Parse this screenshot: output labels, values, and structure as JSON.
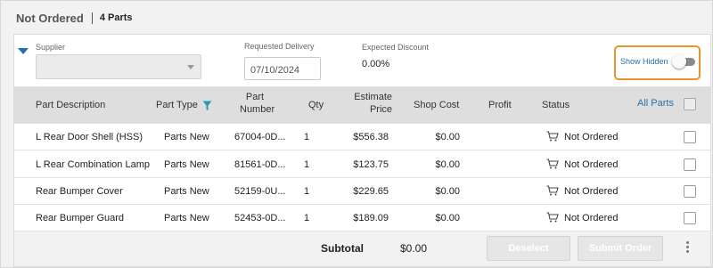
{
  "header": {
    "title": "Not Ordered",
    "count": "4 Parts"
  },
  "filters": {
    "supplier_label": "Supplier",
    "supplier_value": "",
    "requested_delivery_label": "Requested Delivery",
    "requested_delivery_value": "07/10/2024",
    "expected_discount_label": "Expected Discount",
    "expected_discount_value": "0.00%",
    "show_hidden_label": "Show Hidden",
    "show_hidden_on": false
  },
  "table": {
    "columns": {
      "part_description": "Part Description",
      "part_type": "Part Type",
      "part_number_1": "Part",
      "part_number_2": "Number",
      "qty": "Qty",
      "estimate_price_1": "Estimate",
      "estimate_price_2": "Price",
      "shop_cost": "Shop Cost",
      "profit": "Profit",
      "status": "Status",
      "all_parts": "All Parts"
    },
    "rows": [
      {
        "description": "L Rear Door Shell (HSS)",
        "type": "Parts New",
        "number": "67004-0D...",
        "qty": "1",
        "estimate_price": "$556.38",
        "shop_cost": "$0.00",
        "profit": "",
        "status": "Not Ordered",
        "checked": false
      },
      {
        "description": "L Rear Combination Lamp",
        "type": "Parts New",
        "number": "81561-0D...",
        "qty": "1",
        "estimate_price": "$123.75",
        "shop_cost": "$0.00",
        "profit": "",
        "status": "Not Ordered",
        "checked": false
      },
      {
        "description": "Rear Bumper Cover",
        "type": "Parts New",
        "number": "52159-0U...",
        "qty": "1",
        "estimate_price": "$229.65",
        "shop_cost": "$0.00",
        "profit": "",
        "status": "Not Ordered",
        "checked": false
      },
      {
        "description": "Rear Bumper Guard",
        "type": "Parts New",
        "number": "52453-0D...",
        "qty": "1",
        "estimate_price": "$189.09",
        "shop_cost": "$0.00",
        "profit": "",
        "status": "Not Ordered",
        "checked": false
      }
    ]
  },
  "footer": {
    "subtotal_label": "Subtotal",
    "subtotal_value": "$0.00",
    "deselect_label": "Deselect",
    "submit_label": "Submit Order"
  },
  "icons": {
    "collapse": "triangle-down-icon",
    "filter": "funnel-icon",
    "cart": "cart-icon",
    "more": "kebab-menu-icon"
  },
  "colors": {
    "accent": "#2a6fa8",
    "highlight_border": "#e8942c",
    "header_bg": "#dedede"
  }
}
